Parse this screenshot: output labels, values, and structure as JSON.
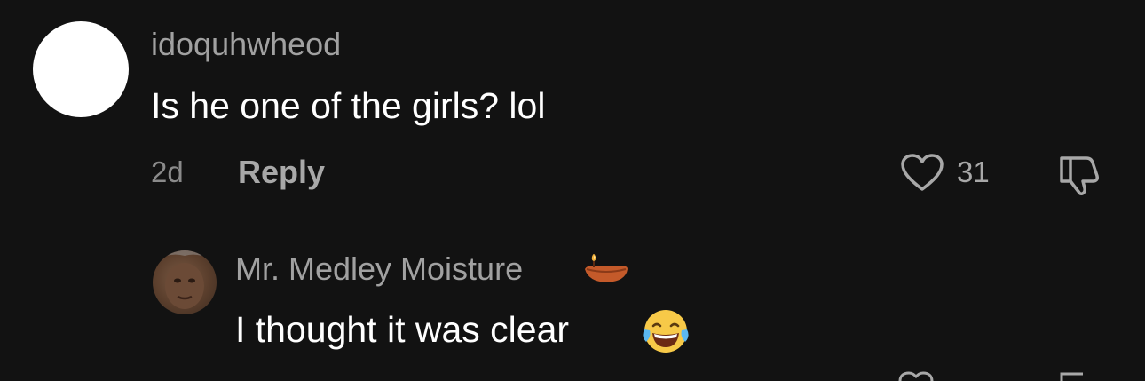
{
  "comment": {
    "username": "idoquhwheod",
    "text": "Is he one of the girls? lol",
    "timestamp": "2d",
    "reply_label": "Reply",
    "like_count": "31",
    "like_icon": "heart-outline-icon",
    "dislike_icon": "thumbs-down-icon"
  },
  "reply": {
    "username": "Mr. Medley Moisture",
    "username_emoji": "diya-lamp-emoji",
    "text": "I thought it was clear",
    "text_emoji": "laughing-crying-emoji"
  },
  "colors": {
    "background": "#121212",
    "primary_text": "#ffffff",
    "secondary_text": "#a1a1a1"
  }
}
